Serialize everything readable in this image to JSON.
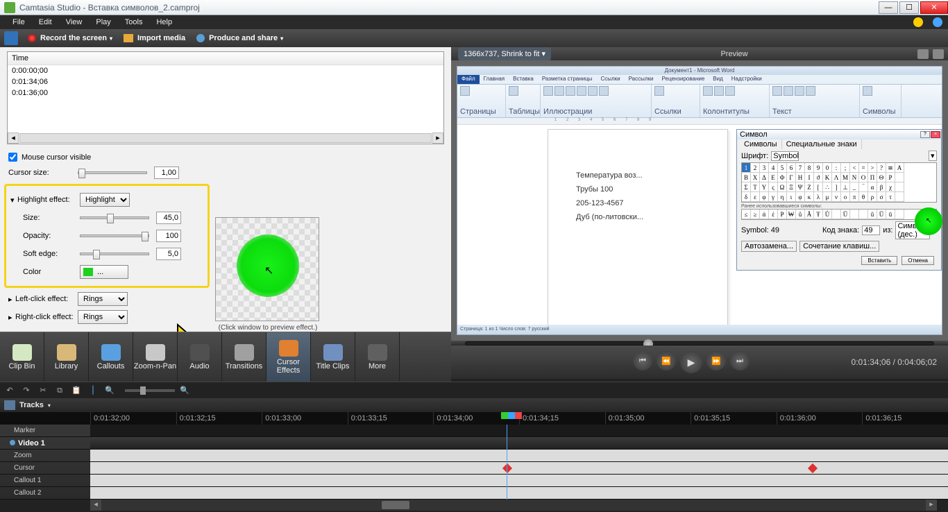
{
  "app_title": "Camtasia Studio - Вставка символов_2.camproj",
  "menu": [
    "File",
    "Edit",
    "View",
    "Play",
    "Tools",
    "Help"
  ],
  "toolbar": {
    "record": "Record the screen",
    "import": "Import media",
    "produce": "Produce and share"
  },
  "time_list": {
    "header": "Time",
    "rows": [
      "0:00:00;00",
      "0:01:34;06",
      "0:01:36;00"
    ]
  },
  "cursor_panel": {
    "visible": "Mouse cursor visible",
    "cursor_size": "Cursor size:",
    "cursor_size_val": "1,00",
    "highlight_effect": "Highlight effect:",
    "highlight_sel": "Highlight",
    "size": "Size:",
    "size_val": "45,0",
    "opacity": "Opacity:",
    "opacity_val": "100",
    "soft_edge": "Soft edge:",
    "soft_edge_val": "5,0",
    "color": "Color",
    "color_val": "#20d020",
    "dots": "...",
    "left_click": "Left-click effect:",
    "left_sel": "Rings",
    "right_click": "Right-click effect:",
    "right_sel": "Rings",
    "preview_caption": "(Click window to preview effect.)"
  },
  "preview_header": {
    "dim": "1366x737, Shrink to fit",
    "label": "Preview"
  },
  "word_mock": {
    "title": "Документ1 - Microsoft Word",
    "tab_file": "Файл",
    "tabs": [
      "Главная",
      "Вставка",
      "Разметка страницы",
      "Ссылки",
      "Рассылки",
      "Рецензирование",
      "Вид",
      "Надстройки"
    ],
    "doc_lines": [
      "Температура воз...",
      "Трубы 100",
      "205-123-4567",
      "Дуб (по-литовски..."
    ],
    "dlg_title": "Символ",
    "dlg_tabs": [
      "Символы",
      "Специальные знаки"
    ],
    "font_lbl": "Шрифт:",
    "font_val": "Symbol",
    "grid": [
      [
        "1",
        "2",
        "3",
        "4",
        "5",
        "6",
        "7",
        "8",
        "9",
        "0",
        ":",
        ";",
        "<",
        "=",
        ">",
        "?",
        "≅",
        "Α"
      ],
      [
        "Β",
        "Χ",
        "Δ",
        "Ε",
        "Φ",
        "Γ",
        "Η",
        "Ι",
        "ϑ",
        "Κ",
        "Λ",
        "Μ",
        "Ν",
        "Ο",
        "Π",
        "Θ",
        "Ρ",
        ""
      ],
      [
        "Σ",
        "Τ",
        "Υ",
        "ς",
        "Ω",
        "Ξ",
        "Ψ",
        "Ζ",
        "[",
        "∴",
        "]",
        "⊥",
        "_",
        "‾",
        "α",
        "β",
        "χ",
        ""
      ],
      [
        "δ",
        "ε",
        "φ",
        "γ",
        "η",
        "ι",
        "φ",
        "κ",
        "λ",
        "μ",
        "ν",
        "ο",
        "π",
        "θ",
        "ρ",
        "σ",
        "τ",
        ""
      ]
    ],
    "recent_lbl": "Ранее использовавшиеся символы:",
    "recent": [
      "≤",
      "≥",
      "ά",
      "έ",
      "Ҏ",
      "₩",
      "ů",
      "Ă",
      "Ŧ",
      "Ů",
      "",
      "Ū",
      "",
      "",
      "ũ",
      "Ū",
      "ū",
      ""
    ],
    "code_lbl": "Symbol: 49",
    "set_lbl": "Код знака:",
    "set_val": "49",
    "from_lbl": "из:",
    "from_val": "Символ (дес.)",
    "btn_auto": "Автозамена...",
    "btn_combo": "Сочетание клавиш...",
    "btn_insert": "Вставить",
    "btn_cancel": "Отмена",
    "status": "Страница: 1 из 1   Число слов: 7   русский"
  },
  "playback": {
    "time": "0:01:34;06 / 0:04:06;02"
  },
  "tools": [
    {
      "name": "clip-bin",
      "label": "Clip Bin",
      "icon": "#d4e8c4"
    },
    {
      "name": "library",
      "label": "Library",
      "icon": "#d8b878"
    },
    {
      "name": "callouts",
      "label": "Callouts",
      "icon": "#5aa0e0"
    },
    {
      "name": "zoom-n-pan",
      "label": "Zoom-n-Pan",
      "icon": "#c8c8c8"
    },
    {
      "name": "audio",
      "label": "Audio",
      "icon": "#505050"
    },
    {
      "name": "transitions",
      "label": "Transitions",
      "icon": "#a0a0a0"
    },
    {
      "name": "cursor-effects",
      "label": "Cursor Effects",
      "icon": "#e08030",
      "active": true
    },
    {
      "name": "title-clips",
      "label": "Title Clips",
      "icon": "#7090c0"
    },
    {
      "name": "more",
      "label": "More",
      "icon": "#606060"
    }
  ],
  "tracks_label": "Tracks",
  "timeline": {
    "ticks": [
      "0:01:32;00",
      "0:01:32;15",
      "0:01:33;00",
      "0:01:33;15",
      "0:01:34;00",
      "0:01:34;15",
      "0:01:35;00",
      "0:01:35;15",
      "0:01:36;00",
      "0:01:36;15"
    ],
    "tracks": [
      "Marker",
      "Video 1",
      "Zoom",
      "Cursor",
      "Callout 1",
      "Callout 2"
    ]
  }
}
